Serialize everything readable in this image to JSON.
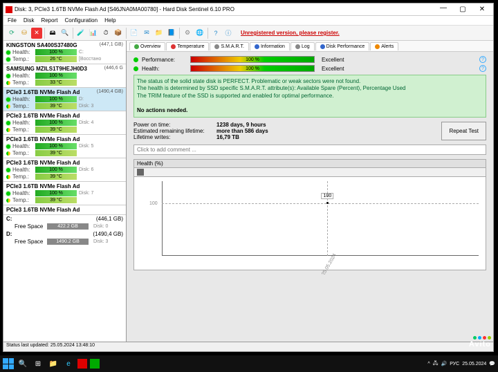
{
  "window": {
    "title": "Disk: 3, PCIe3 1.6TB NVMe Flash Ad [S46JNA0MA00780] - Hard Disk Sentinel 6.10 PRO"
  },
  "menu": {
    "items": [
      "File",
      "Disk",
      "Report",
      "Configuration",
      "Help"
    ]
  },
  "unregistered": "Unregistered version, please register.",
  "disks": [
    {
      "name": "KINGSTON SA400S37480G",
      "size": "(447,1 GB)",
      "health": "100 %",
      "temp": "26 °C",
      "sub": "C:",
      "sub2": "[Восстано",
      "dlabel": ""
    },
    {
      "name": "SAMSUNG MZILS1T9HEJH0D3",
      "size": "(446,6 G",
      "health": "100 %",
      "temp": "33 °C",
      "dlabel": ""
    },
    {
      "name": "PCIe3 1.6TB NVMe Flash Ad",
      "size": "(1490,4 GB)",
      "health": "100 %",
      "temp": "39 °C",
      "sub": "D:",
      "dlabel": "Disk: 3",
      "selected": true
    },
    {
      "name": "PCIe3 1.6TB NVMe Flash Ad",
      "size": "",
      "health": "100 %",
      "temp": "39 °C",
      "dlabel": "Disk: 4"
    },
    {
      "name": "PCIe3 1.6TB NVMe Flash Ad",
      "size": "",
      "health": "100 %",
      "temp": "39 °C",
      "dlabel": "Disk: 5"
    },
    {
      "name": "PCIe3 1.6TB NVMe Flash Ad",
      "size": "",
      "health": "100 %",
      "temp": "39 °C",
      "dlabel": "Disk: 6"
    },
    {
      "name": "PCIe3 1.6TB NVMe Flash Ad",
      "size": "",
      "health": "100 %",
      "temp": "39 °C",
      "dlabel": "Disk: 7"
    },
    {
      "name": "PCIe3 1.6TB NVMe Flash Ad",
      "size": "",
      "health": "",
      "temp": "",
      "dlabel": ""
    }
  ],
  "row_labels": {
    "health": "Health:",
    "temp": "Temp.:",
    "free": "Free Space"
  },
  "vols": [
    {
      "letter": "C:",
      "size": "(446,1 GB)",
      "free": "422.2 GB",
      "dlabel": "Disk: 0"
    },
    {
      "letter": "D:",
      "size": "(1490,4 GB)",
      "free": "1490.2 GB",
      "dlabel": "Disk: 3"
    }
  ],
  "tabs": [
    "Overview",
    "Temperature",
    "S.M.A.R.T.",
    "Information",
    "Log",
    "Disk Performance",
    "Alerts"
  ],
  "kpi": {
    "perf_label": "Performance:",
    "perf_val": "100 %",
    "perf_status": "Excellent",
    "health_label": "Health:",
    "health_val": "100 %",
    "health_status": "Excellent"
  },
  "status": {
    "l1": "The status of the solid state disk is PERFECT. Problematic or weak sectors were not found.",
    "l2": "The health is determined by SSD specific S.M.A.R.T. attribute(s): Available Spare (Percent), Percentage Used",
    "l3": "The TRIM feature of the SSD is supported and enabled for optimal performance.",
    "l4": "No actions needed."
  },
  "stats": {
    "k1": "Power on time:",
    "v1": "1238 days, 9 hours",
    "k2": "Estimated remaining lifetime:",
    "v2": "more than 586 days",
    "k3": "Lifetime writes:",
    "v3": "16,79 TB",
    "repeat": "Repeat Test"
  },
  "comment_placeholder": "Click to add comment ...",
  "chart": {
    "title": "Health (%)",
    "ylab": "100",
    "ptlabel": "100",
    "xdate": "25.05.2024"
  },
  "statusbar": "Status last updated: 25.05.2024 13:48:10",
  "tray": {
    "lang": "РУС",
    "date": "25.05.2024"
  },
  "avito": "Avito"
}
